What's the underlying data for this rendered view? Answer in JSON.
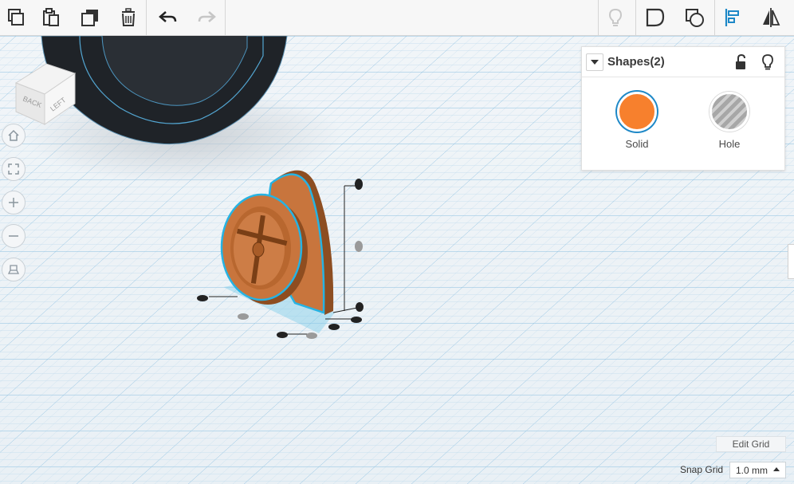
{
  "toolbar": {
    "left_tools": [
      {
        "name": "copy",
        "icon": "copy-icon"
      },
      {
        "name": "paste",
        "icon": "paste-icon"
      },
      {
        "name": "duplicate",
        "icon": "duplicate-icon"
      },
      {
        "name": "delete",
        "icon": "trash-icon"
      },
      {
        "name": "undo",
        "icon": "undo-icon"
      },
      {
        "name": "redo",
        "icon": "redo-icon"
      }
    ],
    "right_tools": [
      {
        "name": "show-all",
        "icon": "lightbulb-icon"
      },
      {
        "name": "group",
        "icon": "group-icon"
      },
      {
        "name": "ungroup",
        "icon": "ungroup-icon"
      },
      {
        "name": "align",
        "icon": "align-icon"
      },
      {
        "name": "mirror",
        "icon": "mirror-icon"
      }
    ]
  },
  "viewcube": {
    "back": "BACK",
    "left": "LEFT"
  },
  "nav": [
    {
      "name": "home",
      "icon": "home-icon"
    },
    {
      "name": "fit-view",
      "icon": "fit-icon"
    },
    {
      "name": "zoom-in",
      "icon": "plus-icon"
    },
    {
      "name": "zoom-out",
      "icon": "minus-icon"
    },
    {
      "name": "projection",
      "icon": "perspective-icon"
    }
  ],
  "panel": {
    "title": "Shapes(2)",
    "materials": [
      {
        "label": "Solid",
        "color": "#f7802d"
      },
      {
        "label": "Hole",
        "color": "#a7a7a7"
      }
    ]
  },
  "grid": {
    "edit_label": "Edit Grid",
    "snap_label": "Snap Grid",
    "snap_value": "1.0 mm"
  },
  "colors": {
    "accent": "#1e88c7",
    "shape": "#c8753d",
    "selection": "#26b3e3",
    "grid_bg": "#eef3f7",
    "grid_line": "#b8d6ea"
  }
}
